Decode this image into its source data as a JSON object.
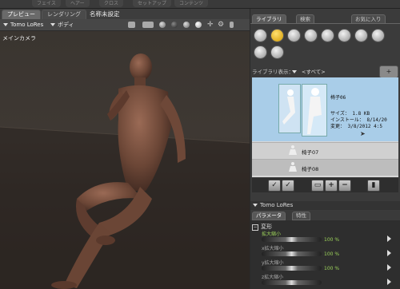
{
  "top_tabs": [
    "フェイス",
    "ヘアー",
    "クロス",
    "セットアップ",
    "コンテンツ"
  ],
  "view_tabs": {
    "preview": "プレビュー",
    "render": "レンダリング",
    "doc_title": "名称未設定"
  },
  "toolbar": {
    "figure": "Tomo LoRes",
    "body_part": "ボディ"
  },
  "viewport": {
    "camera_label": "メインカメラ"
  },
  "library": {
    "tabs": [
      "ライブラリ",
      "検索",
      "お気に入り"
    ],
    "categories": [
      "figures-icon",
      "poses-icon",
      "expressions-icon",
      "hair-icon",
      "hands-icon",
      "props-icon",
      "lights-icon",
      "cameras-icon",
      "materials-icon",
      "scenes-icon"
    ],
    "show_label": "ライブラリ表示：",
    "show_value": "<すべて>",
    "selected_item": {
      "name": "椅子06",
      "size": "サイズ： 1.8 KB",
      "install": "インストール： 8/14/20",
      "modified": "変更： 3/8/2012 4:5"
    },
    "items": [
      "椅子07",
      "椅子08"
    ]
  },
  "scene": {
    "figure_name": "Tomo LoRes",
    "param_tabs": [
      "パラメータ",
      "特性"
    ],
    "group": "変形",
    "params": [
      {
        "name": "拡大縮小",
        "value": "100 %"
      },
      {
        "name": "x拡大縮小",
        "value": "100 %"
      },
      {
        "name": "y拡大縮小",
        "value": "100 %"
      },
      {
        "name": "z拡大縮小",
        "value": ""
      }
    ]
  },
  "colors": {
    "accent_selection": "#a9cde8",
    "param_highlight": "#9bd15a",
    "pose_category": "#f0b400"
  }
}
